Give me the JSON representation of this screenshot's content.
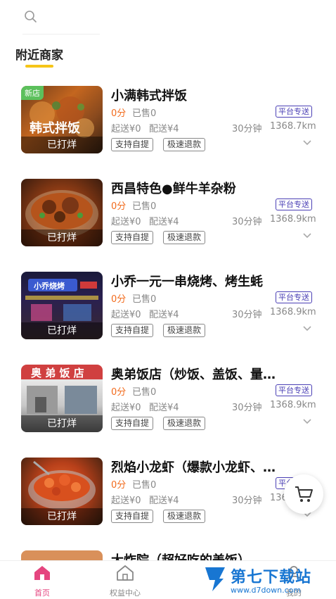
{
  "search": {
    "icon": "search-icon"
  },
  "section": {
    "title": "附近商家"
  },
  "colors": {
    "accent": "#f5c518",
    "brand": "#e5457f",
    "price": "#f26b1d",
    "badge": "#4a3fb5",
    "new": "#5cc05c"
  },
  "shops": [
    {
      "name": "小满韩式拌饭",
      "new_badge": "新店",
      "rating": "0分",
      "sold": "已售0",
      "delivery_badge": "平台专送",
      "min_order": "起送¥0",
      "delivery_fee": "配送¥4",
      "time": "30分钟",
      "distance": "1368.7km",
      "tag1": "支持自提",
      "tag2": "极速退款",
      "status": "已打烊"
    },
    {
      "name": "西昌特色●鲜牛羊杂粉",
      "rating": "0分",
      "sold": "已售0",
      "delivery_badge": "平台专送",
      "min_order": "起送¥0",
      "delivery_fee": "配送¥4",
      "time": "30分钟",
      "distance": "1368.9km",
      "tag1": "支持自提",
      "tag2": "极速退款",
      "status": "已打烊"
    },
    {
      "name": "小乔一元一串烧烤、烤生蚝",
      "rating": "0分",
      "sold": "已售0",
      "delivery_badge": "平台专送",
      "min_order": "起送¥0",
      "delivery_fee": "配送¥4",
      "time": "30分钟",
      "distance": "1368.9km",
      "tag1": "支持自提",
      "tag2": "极速退款",
      "status": "已打烊"
    },
    {
      "name": "奥弟饭店（炒饭、盖饭、量…",
      "rating": "0分",
      "sold": "已售0",
      "delivery_badge": "平台专送",
      "min_order": "起送¥0",
      "delivery_fee": "配送¥4",
      "time": "30分钟",
      "distance": "1368.9km",
      "tag1": "支持自提",
      "tag2": "极速退款",
      "status": "已打烊"
    },
    {
      "name": "烈焰小龙虾（爆款小龙虾、…",
      "rating": "0分",
      "sold": "已售0",
      "delivery_badge": "平台",
      "min_order": "起送¥0",
      "delivery_fee": "配送¥4",
      "time": "30分钟",
      "distance": "136",
      "tag1": "支持自提",
      "tag2": "极速退款",
      "status": "已打烊"
    }
  ],
  "partial_shop": {
    "name": "大炸院（超好吃的美饭）"
  },
  "tabbar": {
    "home": "首页",
    "benefits": "权益中心",
    "mine": "我的"
  },
  "watermark": {
    "text": "第七下载站",
    "url": "www.d7down.com"
  }
}
